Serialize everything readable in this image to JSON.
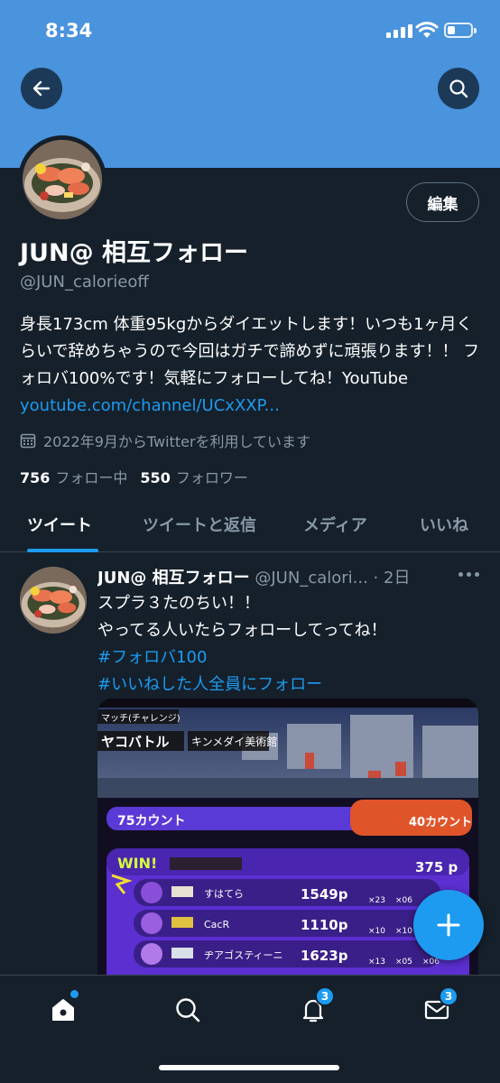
{
  "status_bar": {
    "time": "8:34"
  },
  "profile": {
    "name": "JUN@ 相互フォロー",
    "handle": "@JUN_calorieoff",
    "edit_label": "編集",
    "bio_text": "身長173cm 体重95kgからダイエットします！いつも1ヶ月くらいで辞めちゃうので今回はガチで諦めずに頑張ります！！ フォロバ100%です！気軽にフォローしてね！YouTube ",
    "bio_link": "youtube.com/channel/UCxXXP...",
    "joined": "2022年9月からTwitterを利用しています",
    "following_count": "756",
    "following_label": "フォロー中",
    "followers_count": "550",
    "followers_label": "フォロワー"
  },
  "tabs": [
    {
      "label": "ツイート",
      "active": true
    },
    {
      "label": "ツイートと返信",
      "active": false
    },
    {
      "label": "メディア",
      "active": false
    },
    {
      "label": "いいね",
      "active": false
    }
  ],
  "tweet": {
    "name": "JUN@ 相互フォロー",
    "handle_time": " @JUN_calori... · 2日",
    "line1": "スプラ３たのちい！！",
    "line2": "やってる人いたらフォローしてってね！",
    "hashtag1": "#フォロバ100",
    "hashtag2": "#いいねした人全員にフォロー",
    "media": {
      "header_tag": "マッチ(チャレンジ)",
      "mode": "ヤコバトル",
      "stage": "キンメダイ美術館",
      "left_count": "75カウント",
      "right_count": "40カウント",
      "result": "WIN!",
      "points": "375 p",
      "players": [
        {
          "name": "すはてら",
          "points": "1549p",
          "k": "×23",
          "s": "×06"
        },
        {
          "name": "CacR",
          "points": "1110p",
          "k": "×10",
          "s": "×10"
        },
        {
          "name": "ヂアゴスティーニ",
          "points": "1623p",
          "k": "×13",
          "s": "×05",
          "extra": "×06"
        }
      ]
    }
  },
  "nav": {
    "notifications_badge": "3",
    "messages_badge": "3"
  },
  "colors": {
    "accent": "#1d9bf0",
    "background": "#15202b",
    "banner": "#4a93dd",
    "secondary_text": "#8899a6"
  }
}
